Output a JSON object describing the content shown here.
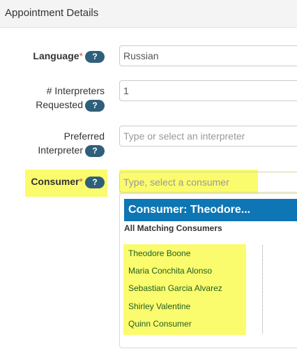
{
  "header": {
    "title": "Appointment Details"
  },
  "form": {
    "language": {
      "label": "Language",
      "required": "*",
      "help": "?",
      "value": "Russian"
    },
    "interpreters": {
      "label_line1": "# Interpreters",
      "label_line2": "Requested",
      "help": "?",
      "value": "1"
    },
    "preferred": {
      "label_line1": "Preferred",
      "label_line2": "Interpreter",
      "help": "?",
      "placeholder": "Type or select an interpreter"
    },
    "consumer": {
      "label": "Consumer",
      "required": "*",
      "help": "?",
      "placeholder": "Type, select a consumer"
    }
  },
  "dropdown": {
    "header": "Consumer: Theodore...",
    "subheader": "All Matching Consumers",
    "items": [
      "Theodore Boone",
      "Maria Conchita Alonso",
      "Sebastian Garcia Alvarez",
      "Shirley Valentine",
      "Quinn Consumer"
    ]
  },
  "colors": {
    "highlight": "#fbfb6e",
    "help_badge": "#2f5f7a",
    "dropdown_header": "#0e76b4",
    "item_text": "#1f5f1f",
    "required": "#d9534f"
  }
}
